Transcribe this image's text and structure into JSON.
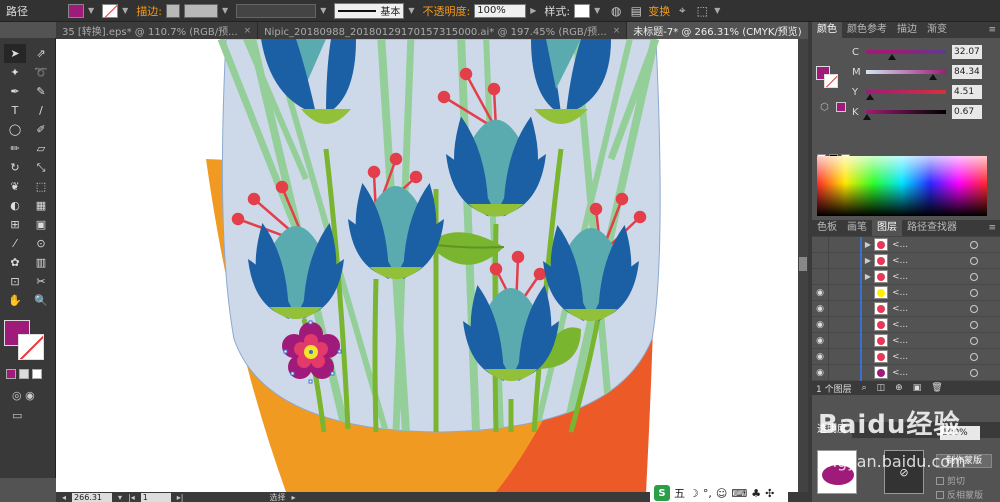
{
  "control_bar": {
    "object_type": "路径",
    "fill_color": "#a01a79",
    "stroke_label": "描边:",
    "stroke_style": "基本",
    "opacity_label": "不透明度:",
    "opacity_value": "100%",
    "style_label": "样式:",
    "transform_label": "变换"
  },
  "tabs": [
    {
      "label": "35 [转换].eps* @ 110.7% (RGB/预...",
      "close": "×"
    },
    {
      "label": "Nipic_20180988_20180129170157315000.ai* @ 197.45% (RGB/预...",
      "close": "×"
    },
    {
      "label": "未标题-7* @ 266.31% (CMYK/预览)",
      "close": "×",
      "active": true
    }
  ],
  "tools": [
    "selection",
    "direct-selection",
    "magic-wand",
    "lasso",
    "pen",
    "curvature",
    "type",
    "line",
    "ellipse",
    "paintbrush",
    "pencil",
    "eraser",
    "rotate",
    "scale",
    "warp",
    "free-transform",
    "shape-builder",
    "perspective",
    "mesh",
    "gradient",
    "eyedropper",
    "blend",
    "symbol-sprayer",
    "column-graph",
    "artboard",
    "slice",
    "hand",
    "zoom"
  ],
  "fill_stroke": {
    "fill": "#a01a79",
    "stroke": "none"
  },
  "status_bar": {
    "zoom": "266.31",
    "page": "1",
    "tool_name": "选择"
  },
  "color_panel": {
    "tabs": [
      "颜色",
      "颜色参考",
      "描边",
      "渐变"
    ],
    "fill": "#a01a79",
    "channels": [
      {
        "name": "C",
        "value": "32.07",
        "pos": 0.32,
        "gradient": "linear-gradient(to right, #a3197a, #a01a79 40%, #5a3b91)"
      },
      {
        "name": "M",
        "value": "84.34",
        "pos": 0.84,
        "gradient": "linear-gradient(to right, #d4e4f3, #a01a79)"
      },
      {
        "name": "Y",
        "value": "4.51",
        "pos": 0.05,
        "gradient": "linear-gradient(to right, #a01a79, #d92f3b)"
      },
      {
        "name": "K",
        "value": "0.67",
        "pos": 0.01,
        "gradient": "linear-gradient(to right, #a01a79, #000)"
      }
    ]
  },
  "layers_panel": {
    "tabs": [
      "色板",
      "画笔",
      "图层",
      "路径查找器"
    ],
    "rows": [
      {
        "name": "<...",
        "color": "#e53a55",
        "expand": "▶",
        "visible": ""
      },
      {
        "name": "<...",
        "color": "#e53a55",
        "expand": "▶",
        "visible": ""
      },
      {
        "name": "<...",
        "color": "#e53a55",
        "expand": "▶",
        "visible": ""
      },
      {
        "name": "<...",
        "color": "#ffef00",
        "expand": "",
        "visible": "◉"
      },
      {
        "name": "<...",
        "color": "#e53a55",
        "expand": "",
        "visible": "◉"
      },
      {
        "name": "<...",
        "color": "#e53a55",
        "expand": "",
        "visible": "◉"
      },
      {
        "name": "<...",
        "color": "#e53a55",
        "expand": "",
        "visible": "◉"
      },
      {
        "name": "<...",
        "color": "#e53a55",
        "expand": "",
        "visible": "◉"
      },
      {
        "name": "<...",
        "color": "#a01a79",
        "expand": "",
        "visible": "◉"
      }
    ],
    "footer": "1 个图层"
  },
  "transparency_panel": {
    "tab": "透明度",
    "opacity": "100%",
    "make_mask": "制作蒙版",
    "clip": "剪切",
    "invert": "反相蒙版"
  },
  "ime": {
    "logo": "S",
    "mode": "五"
  },
  "watermark": {
    "main": "Baidu经验",
    "sub": "jingyan.baidu.com"
  }
}
